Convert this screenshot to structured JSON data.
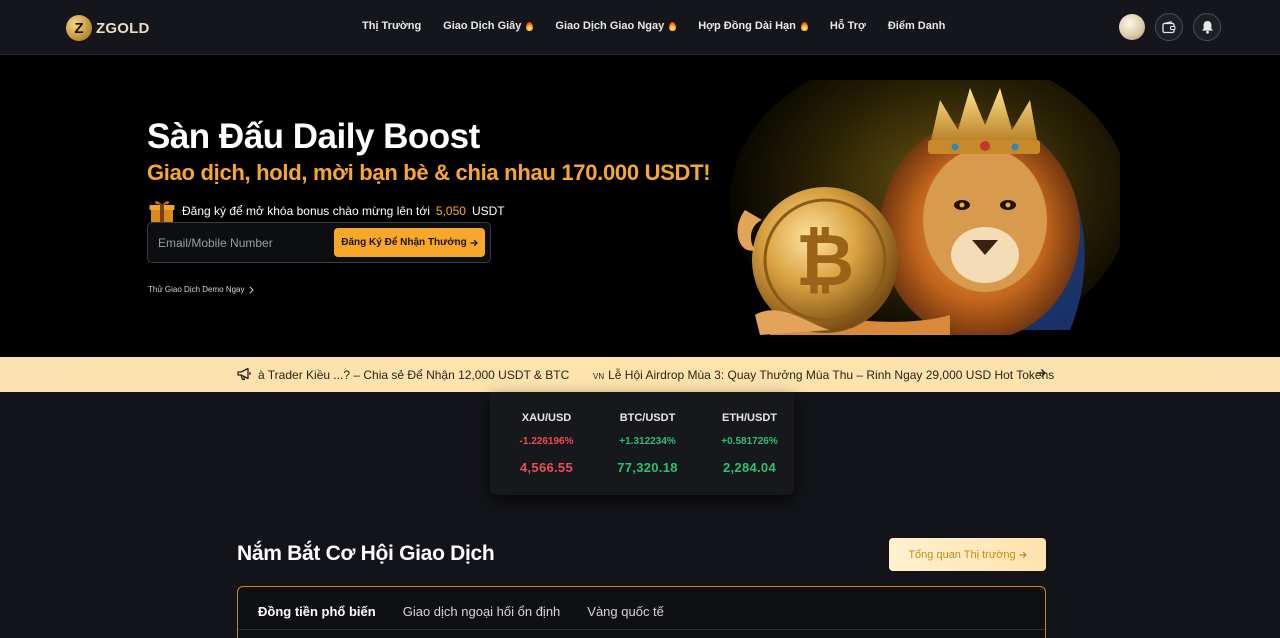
{
  "brand": {
    "name": "ZGOLD",
    "mark": "Z"
  },
  "nav": {
    "items": [
      {
        "label": "Thị Trường",
        "hot": false
      },
      {
        "label": "Giao Dịch Giây",
        "hot": true
      },
      {
        "label": "Giao Dịch Giao Ngay",
        "hot": true
      },
      {
        "label": "Hợp Đồng Dài Hạn",
        "hot": true
      },
      {
        "label": "Hỗ Trợ",
        "hot": false
      },
      {
        "label": "Điểm Danh",
        "hot": false
      }
    ],
    "icons": [
      "avatar",
      "wallet-icon",
      "bell-icon"
    ]
  },
  "hero": {
    "title": "Sàn Đấu Daily Boost",
    "subtitle": "Giao dịch, hold, mời bạn bè & chia nhau 170.000 USDT!",
    "bonus_prefix": "Đăng ký để mở khóa bonus chào mừng lên tới",
    "bonus_amount": "5,050",
    "bonus_unit": "USDT",
    "input_placeholder": "Email/Mobile Number",
    "signup_label": "Đăng Ký Để Nhận Thưởng",
    "demo_link": "Thử Giao Dịch Demo Ngay"
  },
  "announcements": {
    "item1": "à Trader Kiều ...? – Chia sẻ Để Nhận 12,000 USDT & BTC",
    "item2_tag": "VN",
    "item2": "Lễ Hội Airdrop Mùa 3: Quay Thưởng Mùa Thu – Rinh Ngay 29,000 USD Hot Tokens"
  },
  "ticker": [
    {
      "symbol": "XAU/USD",
      "change": "-1.226196%",
      "price": "4,566.55",
      "direction": "down"
    },
    {
      "symbol": "BTC/USDT",
      "change": "+1.312234%",
      "price": "77,320.18",
      "direction": "up"
    },
    {
      "symbol": "ETH/USDT",
      "change": "+0.581726%",
      "price": "2,284.04",
      "direction": "up"
    }
  ],
  "opportunities": {
    "title": "Nắm Bắt Cơ Hội Giao Dịch",
    "overview_label": "Tổng quan Thị trường",
    "tabs": [
      "Đồng tiền phổ biến",
      "Giao dịch ngoại hối ổn định",
      "Vàng quốc tế"
    ],
    "active_tab": 0
  },
  "colors": {
    "accent": "#f7a82a",
    "positive": "#2fbf73",
    "negative": "#ea4d52",
    "announce_bg": "#ffe3ab"
  }
}
